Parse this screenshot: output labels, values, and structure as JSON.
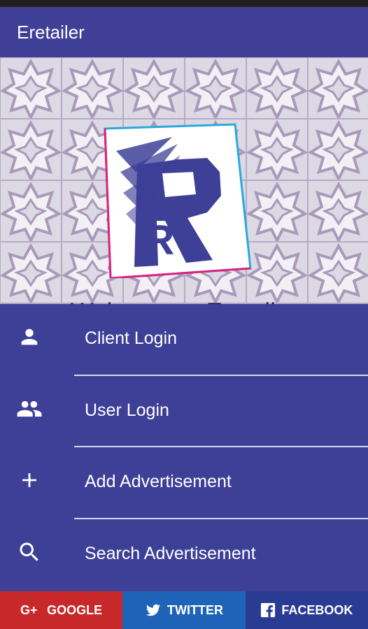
{
  "app": {
    "title": "Eretailer"
  },
  "hero": {
    "welcome_text": "Welcome to Eretailer",
    "logo_letter": "R"
  },
  "menu": {
    "items": [
      {
        "label": "Client Login",
        "icon": "person-icon"
      },
      {
        "label": "User Login",
        "icon": "people-icon"
      },
      {
        "label": "Add Advertisement",
        "icon": "plus-icon"
      },
      {
        "label": "Search Advertisement",
        "icon": "search-icon"
      }
    ]
  },
  "social": {
    "google": "GOOGLE",
    "twitter": "TWITTER",
    "facebook": "FACEBOOK"
  },
  "colors": {
    "primary": "#3f3f97",
    "google": "#c8282a",
    "twitter": "#1e63b7",
    "facebook": "#2a3b94"
  }
}
